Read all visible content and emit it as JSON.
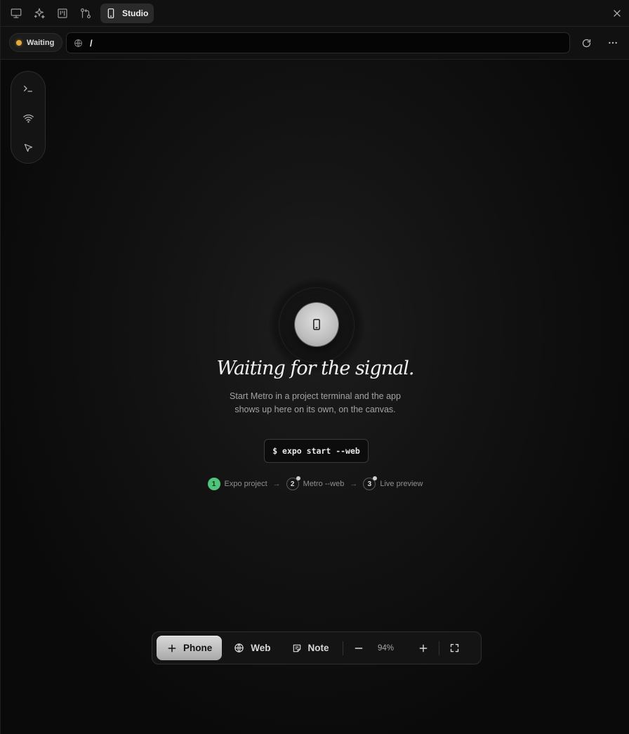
{
  "tabbar": {
    "tabs": [
      {
        "icon": "monitor-icon"
      },
      {
        "icon": "sparkles-icon"
      },
      {
        "icon": "kanban-icon"
      },
      {
        "icon": "git-compare-icon"
      }
    ],
    "active_tab": {
      "icon": "smartphone-icon",
      "label": "Studio"
    },
    "close_icon": "close-icon"
  },
  "addressbar": {
    "status_label": "Waiting",
    "status_color": "#e7a93a",
    "url_value": "/",
    "refresh_icon": "refresh-icon",
    "more_icon": "more-horizontal-icon"
  },
  "toolrail": {
    "items": [
      {
        "icon": "terminal-icon"
      },
      {
        "icon": "wifi-icon"
      },
      {
        "icon": "pointer-icon"
      }
    ]
  },
  "empty_state": {
    "headline": "Waiting for the signal.",
    "description": "Start Metro in a project terminal and the app shows up here on its own, on the canvas.",
    "command": "$ expo start --web",
    "steps": [
      {
        "number": "1",
        "label": "Expo project",
        "done": true
      },
      {
        "number": "2",
        "label": "Metro --web",
        "done": false
      },
      {
        "number": "3",
        "label": "Live preview",
        "done": false
      }
    ],
    "arrow": "→",
    "accent_done": "#4fc47a"
  },
  "bottombar": {
    "phone_label": "Phone",
    "web_label": "Web",
    "note_label": "Note",
    "zoom": "94%"
  }
}
